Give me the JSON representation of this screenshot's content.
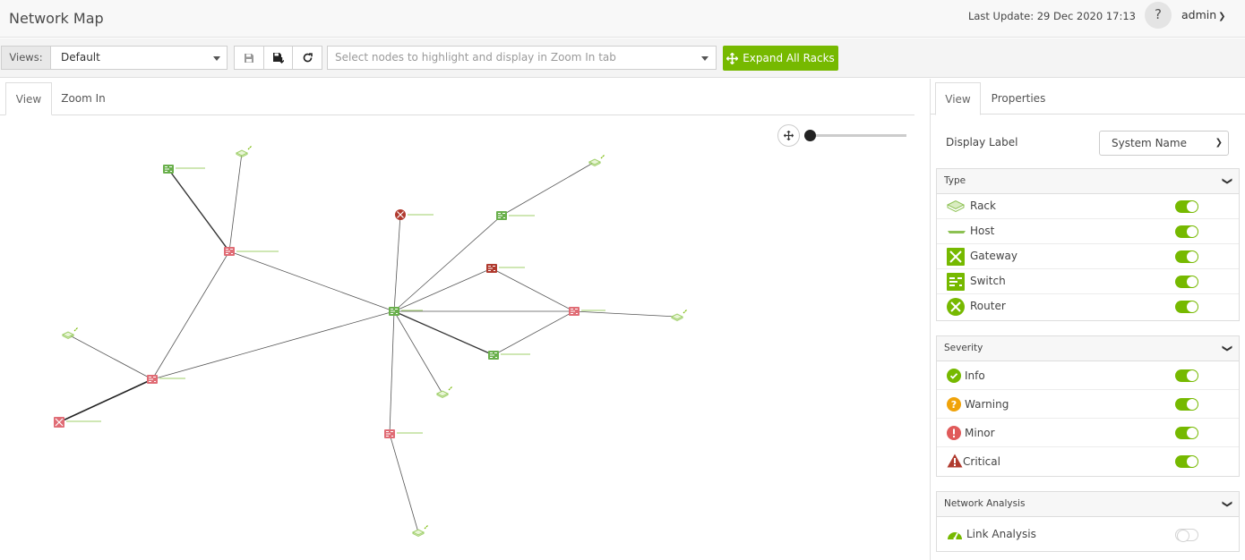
{
  "header": {
    "title": "Network Map",
    "last_update": "Last Update: 29 Dec 2020 17:13",
    "help_label": "?",
    "user": "admin"
  },
  "toolbar": {
    "views_label": "Views:",
    "views_value": "Default",
    "node_select_placeholder": "Select nodes to highlight and display in Zoom In tab",
    "expand_button": "Expand All Racks"
  },
  "left_tabs": [
    "View",
    "Zoom In"
  ],
  "right_tabs": [
    "View",
    "Properties"
  ],
  "display_label": {
    "label": "Display Label",
    "value": "System Name"
  },
  "type_section": {
    "title": "Type",
    "items": [
      {
        "label": "Rack",
        "icon": "rack-icon",
        "enabled": true
      },
      {
        "label": "Host",
        "icon": "host-icon",
        "enabled": true
      },
      {
        "label": "Gateway",
        "icon": "gateway-icon",
        "enabled": true
      },
      {
        "label": "Switch",
        "icon": "switch-icon",
        "enabled": true
      },
      {
        "label": "Router",
        "icon": "router-icon",
        "enabled": true
      }
    ]
  },
  "severity_section": {
    "title": "Severity",
    "items": [
      {
        "label": "Info",
        "icon": "info-icon",
        "color": "#76b900",
        "enabled": true
      },
      {
        "label": "Warning",
        "icon": "warning-icon",
        "color": "#f0a30a",
        "enabled": true
      },
      {
        "label": "Minor",
        "icon": "minor-icon",
        "color": "#e05a5a",
        "enabled": true
      },
      {
        "label": "Critical",
        "icon": "critical-icon",
        "color": "#b03a2e",
        "enabled": true
      }
    ]
  },
  "network_section": {
    "title": "Network Analysis",
    "items": [
      {
        "label": "Link Analysis",
        "icon": "link-analysis-icon",
        "enabled": false
      }
    ]
  },
  "colors": {
    "accent": "#76b900",
    "switch_info": "#6ab04c",
    "switch_minor": "#e06c75",
    "critical": "#b03a2e"
  }
}
